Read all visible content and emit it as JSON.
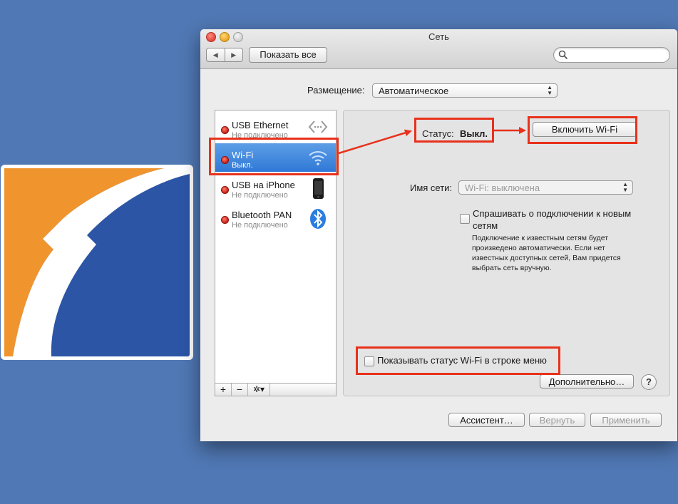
{
  "colors": {
    "desktop": "#5078b4",
    "annotation_red": "#e8311b",
    "selection_blue": "#2f78d6",
    "logo_orange": "#f0952e",
    "logo_blue": "#2c55a6"
  },
  "window": {
    "title": "Сеть",
    "nav_back": "◀",
    "nav_forward": "▶",
    "show_all_label": "Показать все",
    "search_placeholder": ""
  },
  "location": {
    "label": "Размещение:",
    "value": "Автоматическое"
  },
  "services": [
    {
      "name": "USB Ethernet",
      "status": "Не подключено",
      "icon": "ethernet-arrows-icon",
      "selected": false
    },
    {
      "name": "Wi-Fi",
      "status": "Выкл.",
      "icon": "wifi-icon",
      "selected": true
    },
    {
      "name": "USB на iPhone",
      "status": "Не подключено",
      "icon": "iphone-icon",
      "selected": false
    },
    {
      "name": "Bluetooth PAN",
      "status": "Не подключено",
      "icon": "bluetooth-icon",
      "selected": false
    }
  ],
  "service_toolbar": {
    "add": "+",
    "remove": "−",
    "gear": "✲▾"
  },
  "detail": {
    "status_label": "Статус:",
    "status_value": "Выкл.",
    "turn_on_button": "Включить Wi-Fi",
    "network_name_label": "Имя сети:",
    "network_name_value": "Wi-Fi: выключена",
    "ask_to_join_label": "Спрашивать о подключении к новым сетям",
    "ask_to_join_desc": "Подключение к известным сетям будет произведено автоматически. Если нет известных доступных сетей, Вам придется выбрать сеть вручную.",
    "show_status_label": "Показывать статус Wi-Fi в строке меню",
    "advanced_button": "Дополнительно…",
    "help_button": "?"
  },
  "footer": {
    "assistant_button": "Ассистент…",
    "revert_button": "Вернуть",
    "apply_button": "Применить"
  }
}
